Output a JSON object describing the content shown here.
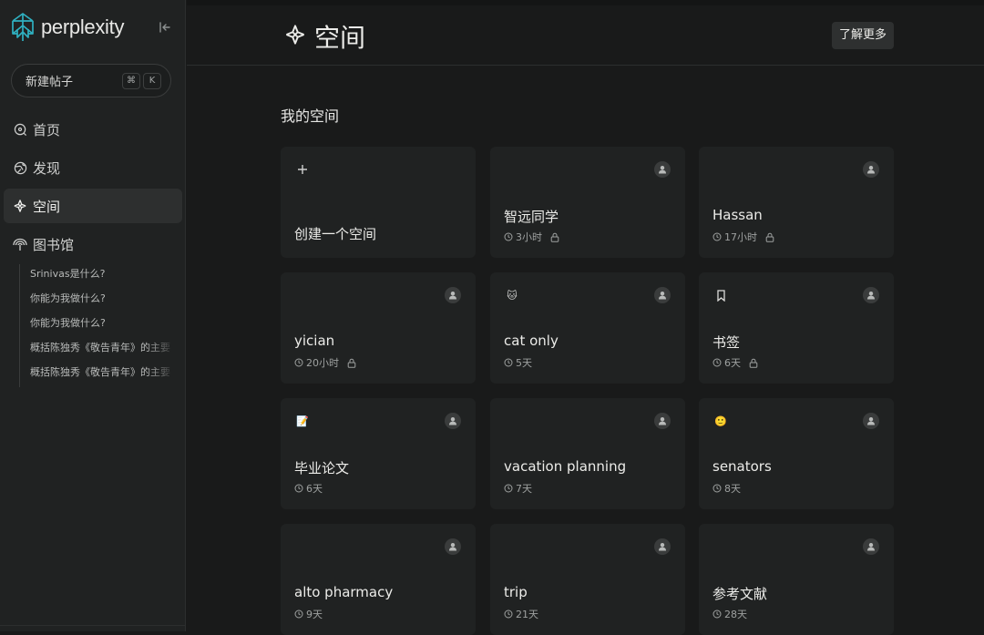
{
  "brand": {
    "name": "perplexity"
  },
  "sidebar": {
    "new_thread_label": "新建帖子",
    "shortcut_keys": [
      "⌘",
      "K"
    ],
    "nav": [
      {
        "label": "首页",
        "icon": "home-search-icon",
        "active": false
      },
      {
        "label": "发现",
        "icon": "globe-icon",
        "active": false
      },
      {
        "label": "空间",
        "icon": "spaces-icon",
        "active": true
      },
      {
        "label": "图书馆",
        "icon": "library-icon",
        "active": false
      }
    ],
    "library_items": [
      "Srinivas是什么?",
      "你能为我做什么?",
      "你能为我做什么?",
      "概括陈独秀《敬告青年》的主要",
      "概括陈独秀《敬告青年》的主要"
    ]
  },
  "header": {
    "title": "空间",
    "learn_more_label": "了解更多"
  },
  "main": {
    "section_title": "我的空间",
    "create_card_label": "创建一个空间",
    "spaces": [
      {
        "name": "智远同学",
        "time": "3小时",
        "locked": true,
        "emoji": ""
      },
      {
        "name": "Hassan",
        "time": "17小时",
        "locked": true,
        "emoji": ""
      },
      {
        "name": "yician",
        "time": "20小时",
        "locked": true,
        "emoji": ""
      },
      {
        "name": "cat only",
        "time": "5天",
        "locked": false,
        "emoji": "🐱"
      },
      {
        "name": "书签",
        "time": "6天",
        "locked": true,
        "emoji": "bookmark-icon"
      },
      {
        "name": "毕业论文",
        "time": "6天",
        "locked": false,
        "emoji": "📝"
      },
      {
        "name": "vacation planning",
        "time": "7天",
        "locked": false,
        "emoji": ""
      },
      {
        "name": "senators",
        "time": "8天",
        "locked": false,
        "emoji": "🙂"
      },
      {
        "name": "alto pharmacy",
        "time": "9天",
        "locked": false,
        "emoji": ""
      },
      {
        "name": "trip",
        "time": "21天",
        "locked": false,
        "emoji": ""
      },
      {
        "name": "参考文献",
        "time": "28天",
        "locked": false,
        "emoji": ""
      }
    ]
  },
  "colors": {
    "background": "#191a1a",
    "sidebar": "#202222",
    "card": "#202222",
    "accent_logo": "#20808d",
    "text": "#ecece9",
    "muted": "#9ea1a0"
  }
}
